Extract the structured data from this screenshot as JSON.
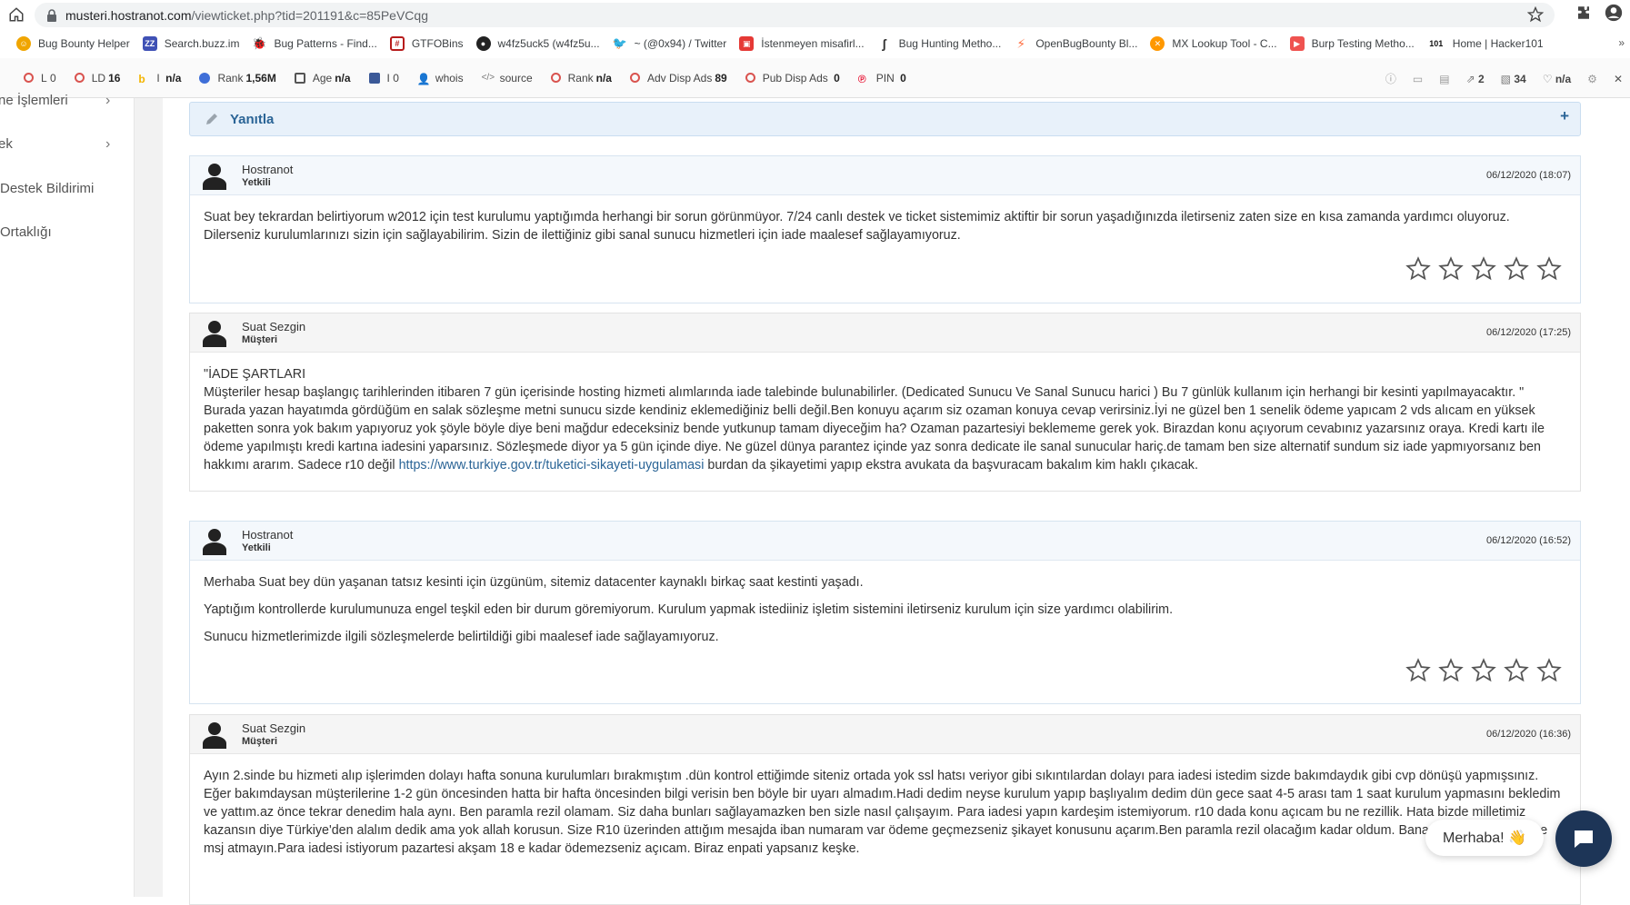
{
  "browser": {
    "url_host": "musteri.hostranot.com",
    "url_path": "/viewticket.php?tid=201191&c=85PeVCqg"
  },
  "bookmarks": [
    {
      "label": "Bug Bounty Helper",
      "icon": "smiley-icon",
      "color": "#f0a500"
    },
    {
      "label": "Search.buzz.im",
      "icon": "buzz-icon",
      "color": "#3f51b5"
    },
    {
      "label": "Bug Patterns - Find...",
      "icon": "bug-icon",
      "color": "#333333"
    },
    {
      "label": "GTFOBins",
      "icon": "grid-icon",
      "color": "#b71c1c"
    },
    {
      "label": "w4fz5uck5 (w4fz5u...",
      "icon": "github-icon",
      "color": "#222222"
    },
    {
      "label": "~ (@0x94) / Twitter",
      "icon": "twitter-icon",
      "color": "#1da1f2"
    },
    {
      "label": "İstenmeyen misafirl...",
      "icon": "page-icon",
      "color": "#e53935"
    },
    {
      "label": "Bug Hunting Metho...",
      "icon": "hook-icon",
      "color": "#333333"
    },
    {
      "label": "OpenBugBounty Bl...",
      "icon": "bolt-icon",
      "color": "#ff7043"
    },
    {
      "label": "MX Lookup Tool - C...",
      "icon": "mx-icon",
      "color": "#ff9800"
    },
    {
      "label": "Burp Testing Metho...",
      "icon": "burp-icon",
      "color": "#ef5350"
    },
    {
      "label": "Home | Hacker101",
      "icon": "hacker101-icon",
      "color": "#111111"
    }
  ],
  "seobar": {
    "items": [
      {
        "label": "L",
        "value": "0"
      },
      {
        "label": "LD",
        "value": "16"
      },
      {
        "label": "I",
        "value": "n/a"
      },
      {
        "label": "Rank",
        "value": "1,56M"
      },
      {
        "label": "Age",
        "value": "n/a"
      },
      {
        "label": "I",
        "value": "0"
      },
      {
        "label": "whois",
        "value": ""
      },
      {
        "label": "source",
        "value": ""
      },
      {
        "label": "Rank",
        "value": "n/a"
      },
      {
        "label": "Adv Disp Ads",
        "value": "89"
      },
      {
        "label": "Pub Disp Ads",
        "value": "0"
      },
      {
        "label": "PIN",
        "value": "0"
      }
    ],
    "right": {
      "links": "2",
      "pages": "34",
      "health": "n/a"
    }
  },
  "leftnav": {
    "items": [
      "ne İşlemleri",
      "ek",
      "Destek Bildirimi",
      " Ortaklığı"
    ]
  },
  "reply": {
    "title": "Yanıtla",
    "plus": "+"
  },
  "messages": [
    {
      "name": "Hostranot",
      "role": "Yetkili",
      "date": "06/12/2020 (18:07)",
      "paragraphs": [
        "Suat bey tekrardan belirtiyorum w2012 için test kurulumu yaptığımda herhangi bir sorun görünmüyor. 7/24 canlı destek ve ticket sistemimiz aktiftir bir sorun yaşadığınızda iletirseniz zaten size en kısa zamanda yardımcı oluyoruz. Dilerseniz kurulumlarınızı sizin için sağlayabilirim. Sizin de ilettiğiniz gibi sanal sunucu hizmetleri için iade maalesef sağlayamıyoruz."
      ]
    },
    {
      "name": "Suat Sezgin",
      "role": "Müşteri",
      "date": "06/12/2020 (17:25)",
      "heading": "\"İADE ŞARTLARI",
      "text": "Müşteriler hesap başlangıç tarihlerinden itibaren 7 gün içerisinde hosting hizmeti alımlarında iade talebinde bulunabilirler. (Dedicated Sunucu Ve Sanal Sunucu harici ) Bu 7 günlük kullanım için herhangi bir kesinti yapılmayacaktır. \" Burada yazan hayatımda gördüğüm en salak sözleşme metni sunucu sizde kendiniz eklemediğiniz belli değil.Ben konuyu açarım siz ozaman konuya cevap verirsiniz.İyi ne güzel ben 1 senelik ödeme yapıcam 2 vds alıcam en yüksek paketten sonra yok bakım yapıyoruz yok şöyle böyle diye beni mağdur edeceksiniz bende yutkunup tamam diyeceğim ha? Ozaman pazartesiyi beklememe gerek yok. Birazdan konu açıyorum cevabınız yazarsınız oraya. Kredi kartı ile ödeme yapılmıştı kredi kartına iadesini yaparsınız. Sözleşmede diyor ya 5 gün içinde diye. Ne güzel dünya parantez içinde yaz sonra dedicate ile sanal sunucular hariç.de tamam ben size alternatif sundum siz iade yapmıyorsanız ben hakkımı ararım. Sadece r10 değil ",
      "link": "https://www.turkiye.gov.tr/tuketici-sikayeti-uygulamasi",
      "after": " burdan da şikayetimi yapıp ekstra avukata da başvuracam bakalım kim haklı çıkacak."
    },
    {
      "name": "Hostranot",
      "role": "Yetkili",
      "date": "06/12/2020 (16:52)",
      "paragraphs": [
        "Merhaba Suat bey dün yaşanan tatsız kesinti için üzgünüm, sitemiz datacenter kaynaklı birkaç saat kestinti yaşadı.",
        "Yaptığım kontrollerde kurulumunuza engel teşkil eden bir durum göremiyorum. Kurulum yapmak istediiniz işletim sistemini iletirseniz kurulum için size yardımcı olabilirim.",
        "Sunucu hizmetlerimizde ilgili sözleşmelerde belirtildiği gibi maalesef iade sağlayamıyoruz."
      ]
    },
    {
      "name": "Suat Sezgin",
      "role": "Müşteri",
      "date": "06/12/2020 (16:36)",
      "paragraphs": [
        "Ayın 2.sinde bu hizmeti alıp işlerimden dolayı hafta sonuna kurulumları bırakmıştım .dün kontrol ettiğimde siteniz ortada yok ssl hatsı veriyor gibi sıkıntılardan dolayı para iadesi istedim sizde bakımdaydık gibi cvp dönüşü yapmışsınız. Eğer bakımdaysan müşterilerine 1-2 gün öncesinden hatta bir hafta öncesinden bilgi verisin ben böyle bir uyarı almadım.Hadi dedim neyse kurulum yapıp başlıyalım dedim dün gece saat 4-5 arası tam 1 saat kurulum yapmasını bekledim ve yattım.az önce tekrar denedim hala aynı. Ben paramla rezil olamam. Siz daha bunları sağlayamazken ben sizle nasıl çalışayım. Para iadesi yapın kardeşim istemiyorum. r10 dada konu açıcam bu ne rezillik. Hata bizde milletimiz kazansın diye Türkiye'den alalım dedik ama yok allah korusun. Size R10 üzerinden attığım mesajda iban numaram var ödeme geçmezseniz şikayet konusunu açarım.Ben paramla rezil olacağım kadar oldum. Bana hallettik buyrun diye msj atmayın.Para iadesi istiyorum pazartesi akşam 18 e kadar ödemezseniz açıcam. Biraz enpati yapsanız keşke."
      ]
    }
  ],
  "chat": {
    "greeting": "Merhaba! 👋"
  }
}
